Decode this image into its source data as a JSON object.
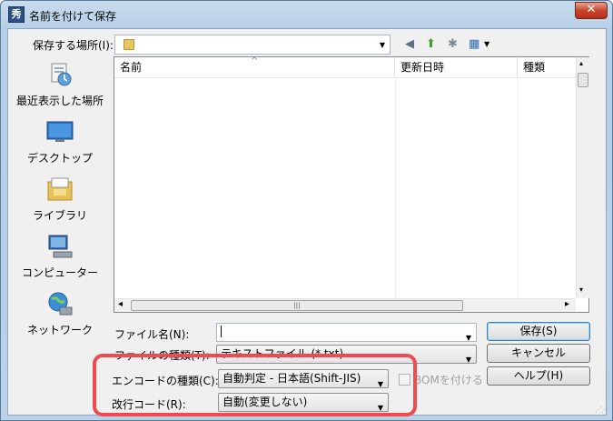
{
  "window": {
    "title": "名前を付けて保存",
    "app_icon_glyph": "秀",
    "close_glyph": "✕"
  },
  "toolbar": {
    "location_label": "保存する場所(I):",
    "location_value": "",
    "back_icon": "◀",
    "up_icon": "⬆",
    "new_folder_icon": "✱",
    "views_icon": "▦"
  },
  "places": [
    {
      "label": "最近表示した場所",
      "icon": "recent-places-icon"
    },
    {
      "label": "デスクトップ",
      "icon": "desktop-icon"
    },
    {
      "label": "ライブラリ",
      "icon": "libraries-icon"
    },
    {
      "label": "コンピューター",
      "icon": "computer-icon"
    },
    {
      "label": "ネットワーク",
      "icon": "network-icon"
    }
  ],
  "filelist": {
    "columns": [
      "名前",
      "更新日時",
      "種類"
    ],
    "sort_indicator": "^",
    "scroll_left": "◂",
    "scroll_right": "▸",
    "scroll_up": "▴",
    "scroll_down": "▾",
    "thumb_grip": "|||"
  },
  "fields": {
    "filename_label": "ファイル名(N):",
    "filename_value": "",
    "filetype_label": "ファイルの種類(T):",
    "filetype_value": "テキストファイル (*.txt)",
    "encoding_label": "エンコードの種類(C):",
    "encoding_value": "自動判定 - 日本語(Shift-JIS)",
    "bom_label": "BOMを付ける",
    "newline_label": "改行コード(R):",
    "newline_value": "自動(変更しない)"
  },
  "buttons": {
    "save": "保存(S)",
    "cancel": "キャンセル",
    "help": "ヘルプ(H)"
  },
  "colors": {
    "highlight": "#ee4a50",
    "close": "#c7452c"
  }
}
